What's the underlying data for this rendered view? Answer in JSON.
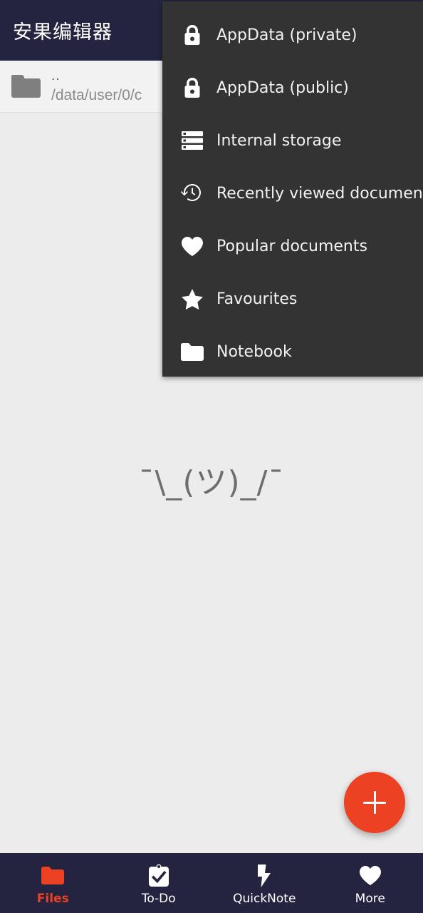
{
  "header": {
    "title": "安果编辑器"
  },
  "path_row": {
    "parent_label": "..",
    "path": "/data/user/0/c",
    "folder_icon": "folder-icon"
  },
  "empty_state": {
    "text": "¯\\_(ツ)_/¯"
  },
  "menu": {
    "items": [
      {
        "label": "AppData (private)",
        "icon": "lock-icon"
      },
      {
        "label": "AppData (public)",
        "icon": "lock-icon"
      },
      {
        "label": "Internal storage",
        "icon": "storage-icon"
      },
      {
        "label": "Recently viewed documents",
        "icon": "history-clock-icon"
      },
      {
        "label": "Popular documents",
        "icon": "heart-icon"
      },
      {
        "label": "Favourites",
        "icon": "star-icon"
      },
      {
        "label": "Notebook",
        "icon": "folder-icon"
      }
    ]
  },
  "fab": {
    "icon": "plus-icon",
    "color": "#ec4122"
  },
  "bottom_nav": {
    "active_color": "#ec4122",
    "items": [
      {
        "label": "Files",
        "icon": "folder-icon",
        "active": true
      },
      {
        "label": "To-Do",
        "icon": "clipboard-check-icon",
        "active": false
      },
      {
        "label": "QuickNote",
        "icon": "lightning-bolt-icon",
        "active": false
      },
      {
        "label": "More",
        "icon": "heart-icon",
        "active": false
      }
    ]
  },
  "colors": {
    "header_bg": "#242440",
    "menu_bg": "#333333",
    "page_bg": "#ececec",
    "accent": "#ec4122"
  }
}
